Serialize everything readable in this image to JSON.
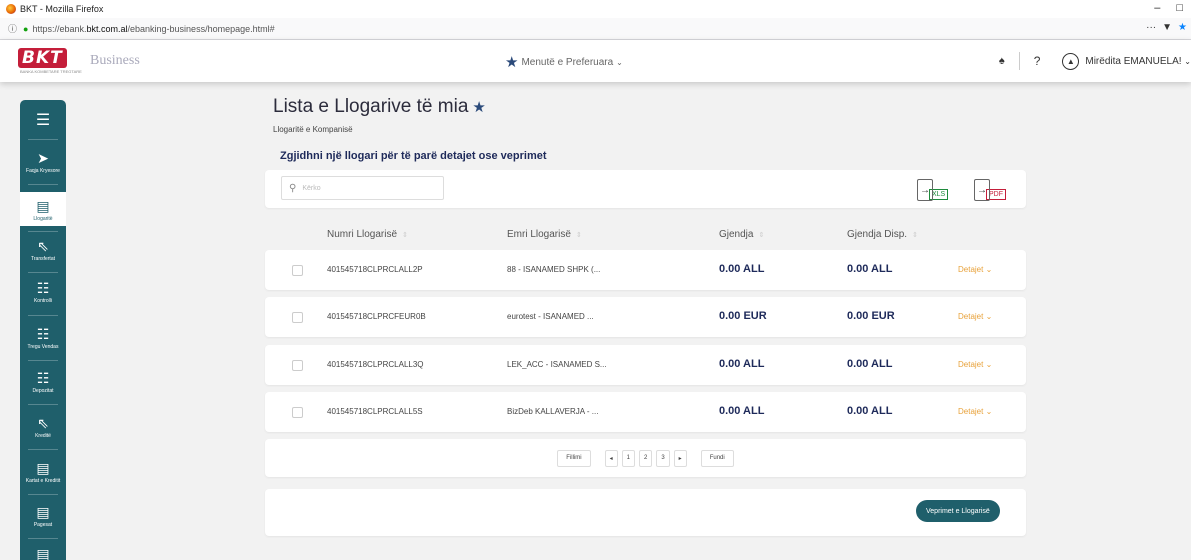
{
  "browser": {
    "window_title": "BKT - Mozilla Firefox",
    "url_prefix": "https://ebank.",
    "url_domain": "bkt.com.al",
    "url_suffix": "/ebanking-business/homepage.html#"
  },
  "header": {
    "logo_text": "BKT",
    "logo_tagline": "BANKA KOMBETARE TREGTARE",
    "brand": "Business",
    "favorites_label": "Menutë e Preferuara",
    "help_label": "?",
    "user_name": "Mirëdita EMANUELA!"
  },
  "sidebar": {
    "items": [
      {
        "label": "Faqja Kryesore",
        "icon": "home-icon"
      },
      {
        "label": "Llogaritë",
        "icon": "account-icon"
      },
      {
        "label": "Transfertat",
        "icon": "transfer-icon"
      },
      {
        "label": "Kontrolli",
        "icon": "control-icon"
      },
      {
        "label": "Tregu Vendas",
        "icon": "market-icon"
      },
      {
        "label": "Depozitat",
        "icon": "deposit-icon"
      },
      {
        "label": "Kreditë",
        "icon": "credit-icon"
      },
      {
        "label": "Kartat e Kreditit",
        "icon": "card-icon"
      },
      {
        "label": "Pagesat",
        "icon": "payment-icon"
      }
    ]
  },
  "main": {
    "title": "Lista e Llogarive të mia",
    "subtitle": "Llogaritë e Kompanisë",
    "instruction": "Zgjidhni një llogari për të parë detajet ose veprimet",
    "search_placeholder": "Kërko",
    "export_xls": "XLS",
    "export_pdf": "PDF",
    "columns": [
      "Numri Llogarisë",
      "Emri Llogarisë",
      "Gjendja",
      "Gjendja Disp."
    ],
    "rows": [
      {
        "account": "401545718CLPRCLALL2P",
        "name": "88 - ISANAMED SHPK (...",
        "balance": "0.00 ALL",
        "available": "0.00 ALL",
        "details": "Detajet"
      },
      {
        "account": "401545718CLPRCFEUR0B",
        "name": "eurotest - ISANAMED ...",
        "balance": "0.00 EUR",
        "available": "0.00 EUR",
        "details": "Detajet"
      },
      {
        "account": "401545718CLPRCLALL3Q",
        "name": "LEK_ACC - ISANAMED S...",
        "balance": "0.00 ALL",
        "available": "0.00 ALL",
        "details": "Detajet"
      },
      {
        "account": "401545718CLPRCLALL5S",
        "name": "BizDeb KALLAVERJA - ...",
        "balance": "0.00 ALL",
        "available": "0.00 ALL",
        "details": "Detajet"
      }
    ],
    "pagination": {
      "first": "Fillimi",
      "prev": "◂",
      "pages": [
        "1",
        "2",
        "3"
      ],
      "next": "▸",
      "last": "Fundi"
    },
    "action_button": "Veprimet e Llogarisë"
  },
  "colors": {
    "sidebar": "#1f5f6b",
    "accent_navy": "#1e2a5a",
    "details_orange": "#e8a23b"
  }
}
